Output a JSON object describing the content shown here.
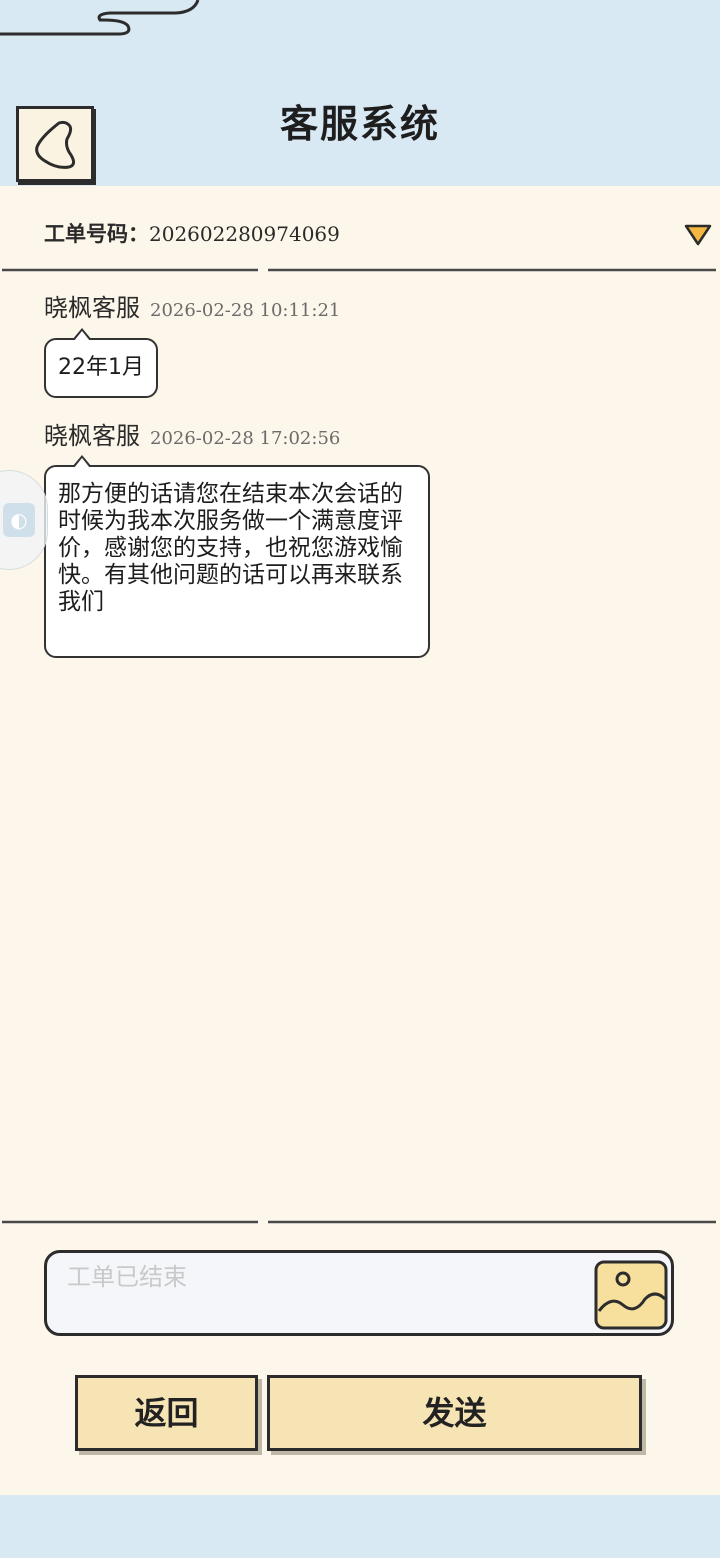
{
  "header": {
    "title": "客服系统",
    "back_icon": "chevron-left-icon"
  },
  "ticket": {
    "label": "工单号码：",
    "number": "202602280974069",
    "dropdown_icon": "triangle-down-icon"
  },
  "messages": [
    {
      "sender": "晓枫客服",
      "time": "2026-02-28 10:11:21",
      "text": "22年1月"
    },
    {
      "sender": "晓枫客服",
      "time": "2026-02-28 17:02:56",
      "text": "那方便的话请您在结束本次会话的时候为我本次服务做一个满意度评价，感谢您的支持，也祝您游戏愉快。有其他问题的话可以再来联系我们"
    }
  ],
  "input": {
    "placeholder": "工单已结束",
    "value": "",
    "image_icon": "image-upload-icon"
  },
  "buttons": {
    "back_label": "返回",
    "send_label": "发送"
  },
  "colors": {
    "header_bg": "#d8e9f4",
    "page_bg": "#fdf6ea",
    "button_bg": "#f7e4b4",
    "accent_orange": "#f5b642"
  }
}
